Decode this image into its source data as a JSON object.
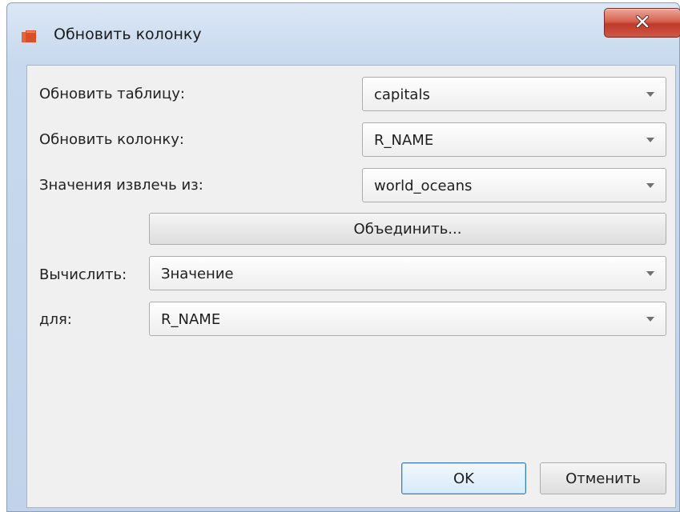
{
  "window": {
    "title": "Обновить колонку",
    "icon": "folder-icon",
    "close_icon": "close-icon"
  },
  "form": {
    "update_table": {
      "label": "Обновить таблицу:",
      "value": "capitals"
    },
    "update_column": {
      "label": "Обновить колонку:",
      "value": "R_NAME"
    },
    "values_from": {
      "label": "Значения извлечь из:",
      "value": "world_oceans"
    },
    "join_button": "Объединить...",
    "calculate": {
      "label": "Вычислить:",
      "value": "Значение"
    },
    "for": {
      "label": "для:",
      "value": "R_NAME"
    }
  },
  "buttons": {
    "ok": "OK",
    "cancel": "Отменить"
  },
  "colors": {
    "close_button": "#c9473a",
    "app_icon": "#d8502a",
    "default_button_border": "#3c7fb1"
  }
}
